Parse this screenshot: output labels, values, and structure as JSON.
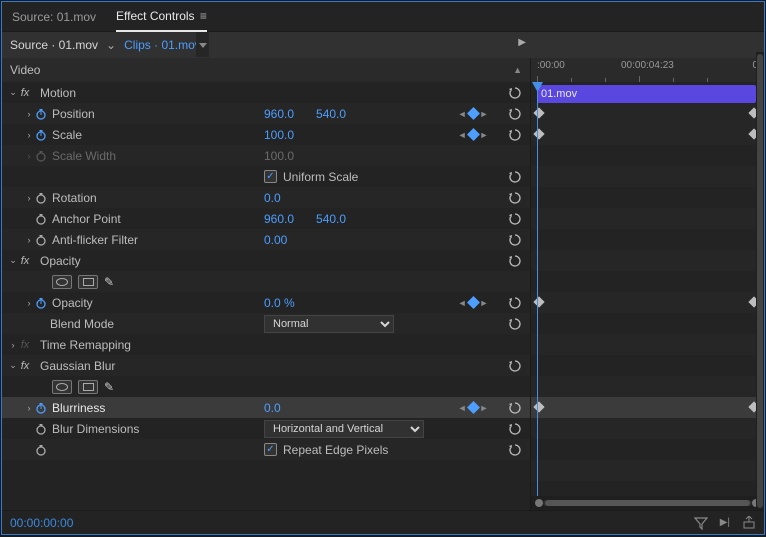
{
  "tabs": {
    "source": "Source: 01.mov",
    "effect_controls": "Effect Controls"
  },
  "srcbar": {
    "source": "Source · 01.mov",
    "clips": "Clips · 01.mov"
  },
  "colhdr": {
    "video": "Video"
  },
  "motion": {
    "label": "Motion",
    "position": {
      "label": "Position",
      "x": "960.0",
      "y": "540.0"
    },
    "scale": {
      "label": "Scale",
      "value": "100.0"
    },
    "scale_width": {
      "label": "Scale Width",
      "value": "100.0"
    },
    "uniform_scale": {
      "label": "Uniform Scale",
      "checked": true
    },
    "rotation": {
      "label": "Rotation",
      "value": "0.0"
    },
    "anchor_point": {
      "label": "Anchor Point",
      "x": "960.0",
      "y": "540.0"
    },
    "antiflicker": {
      "label": "Anti-flicker Filter",
      "value": "0.00"
    }
  },
  "opacity": {
    "label": "Opacity",
    "opacity_prop": {
      "label": "Opacity",
      "value": "0.0 %"
    },
    "blend_mode": {
      "label": "Blend Mode",
      "value": "Normal",
      "options": [
        "Normal"
      ]
    }
  },
  "time_remap": {
    "label": "Time Remapping"
  },
  "gaussian": {
    "label": "Gaussian Blur",
    "blurriness": {
      "label": "Blurriness",
      "value": "0.0"
    },
    "blur_dimensions": {
      "label": "Blur Dimensions",
      "value": "Horizontal and Vertical",
      "options": [
        "Horizontal and Vertical"
      ]
    },
    "repeat_edge": {
      "label": "Repeat Edge Pixels",
      "checked": true
    }
  },
  "timeline": {
    "ruler_labels": [
      ":00:00",
      "00:00:04:23",
      "0"
    ],
    "clip_label": "01.mov"
  },
  "footer": {
    "timecode": "00:00:00:00"
  }
}
